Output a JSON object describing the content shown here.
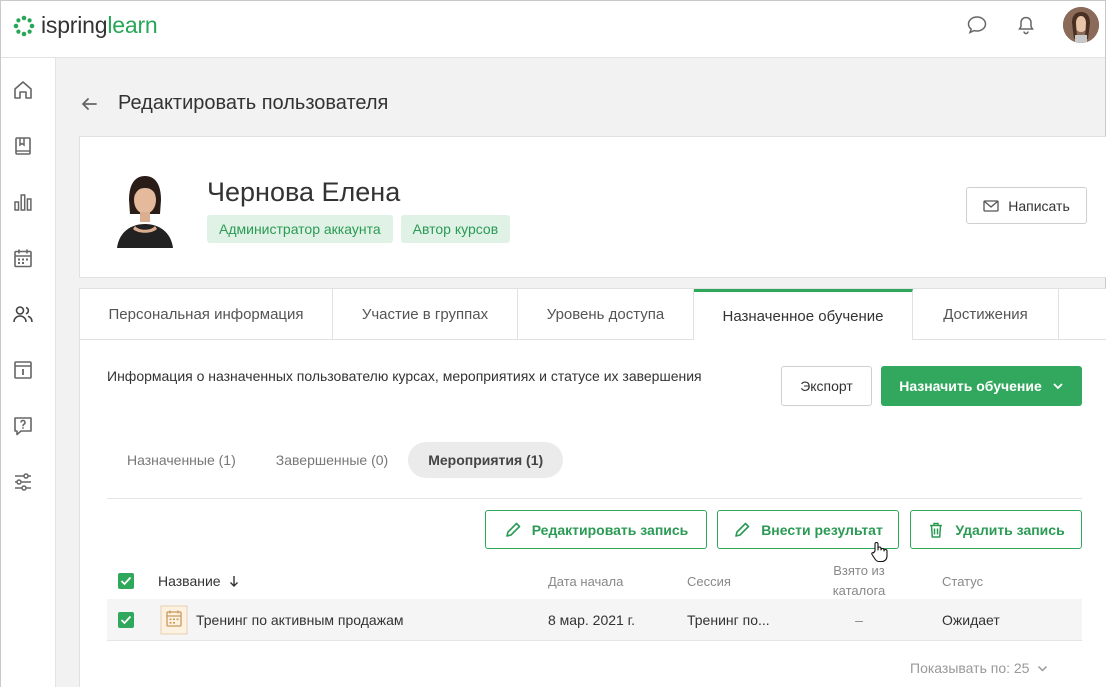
{
  "app": {
    "logo_part1": "ispring",
    "logo_part2": "learn",
    "brand_color": "#27a658"
  },
  "page": {
    "title": "Редактировать пользователя"
  },
  "profile": {
    "name": "Чернова Елена",
    "badges": [
      "Администратор аккаунта",
      "Автор курсов"
    ],
    "write_button": "Написать"
  },
  "tabs": [
    {
      "label": "Персональная информация",
      "active": false
    },
    {
      "label": "Участие в группах",
      "active": false
    },
    {
      "label": "Уровень доступа",
      "active": false
    },
    {
      "label": "Назначенное обучение",
      "active": true
    },
    {
      "label": "Достижения",
      "active": false
    }
  ],
  "assigned": {
    "info": "Информация о назначенных пользователю курсах, мероприятиях и статусе их завершения",
    "export_button": "Экспорт",
    "assign_button": "Назначить обучение"
  },
  "subtabs": [
    {
      "label": "Назначенные (1)",
      "active": false
    },
    {
      "label": "Завершенные (0)",
      "active": false
    },
    {
      "label": "Мероприятия (1)",
      "active": true
    }
  ],
  "actions": {
    "edit": "Редактировать запись",
    "result": "Внести результат",
    "delete": "Удалить запись"
  },
  "table": {
    "headers": {
      "name": "Название",
      "start_date": "Дата начала",
      "session": "Сессия",
      "from_catalog": "Взято из каталога",
      "status": "Статус"
    },
    "rows": [
      {
        "name": "Тренинг по активным продажам",
        "start_date": "8 мар. 2021 г.",
        "session": "Тренинг по...",
        "from_catalog": "–",
        "status": "Ожидает"
      }
    ]
  },
  "pager": {
    "label": "Показывать по: 25"
  }
}
